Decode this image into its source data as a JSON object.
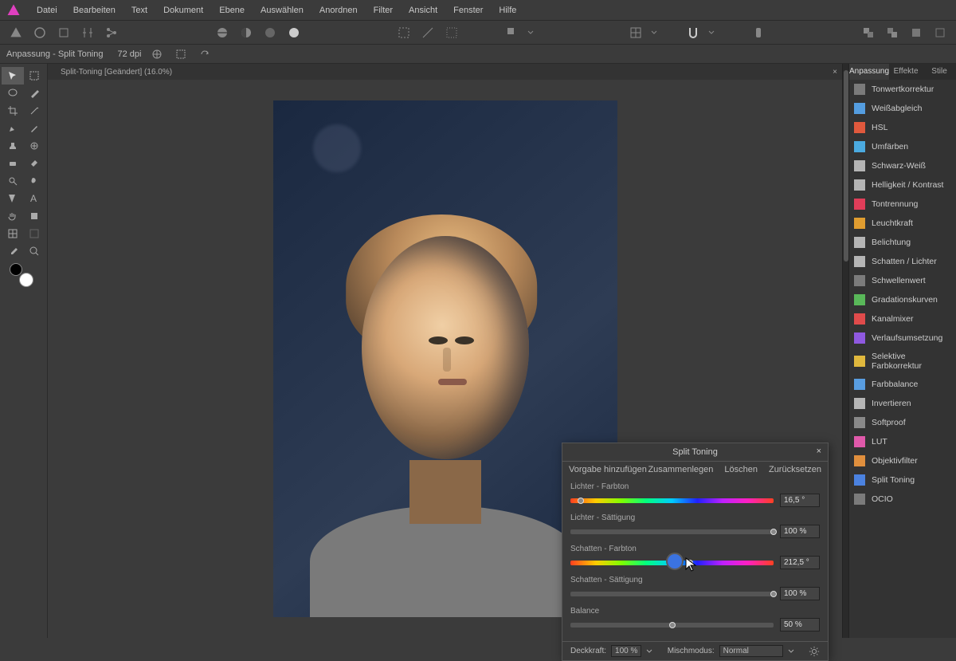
{
  "menu": [
    "Datei",
    "Bearbeiten",
    "Text",
    "Dokument",
    "Ebene",
    "Auswählen",
    "Anordnen",
    "Filter",
    "Ansicht",
    "Fenster",
    "Hilfe"
  ],
  "context": {
    "title": "Anpassung - Split Toning",
    "dpi": "72 dpi"
  },
  "tab": {
    "label": "Split-Toning [Geändert] (16.0%)"
  },
  "right_tabs": [
    "Anpassung",
    "Effekte",
    "Stile"
  ],
  "adjustments": [
    {
      "label": "Tonwertkorrektur",
      "icon": "levels"
    },
    {
      "label": "Weißabgleich",
      "icon": "wb"
    },
    {
      "label": "HSL",
      "icon": "hsl"
    },
    {
      "label": "Umfärben",
      "icon": "recolor"
    },
    {
      "label": "Schwarz-Weiß",
      "icon": "bw"
    },
    {
      "label": "Helligkeit / Kontrast",
      "icon": "bc"
    },
    {
      "label": "Tontrennung",
      "icon": "posterize"
    },
    {
      "label": "Leuchtkraft",
      "icon": "vibrance"
    },
    {
      "label": "Belichtung",
      "icon": "exposure"
    },
    {
      "label": "Schatten / Lichter",
      "icon": "sh"
    },
    {
      "label": "Schwellenwert",
      "icon": "threshold"
    },
    {
      "label": "Gradationskurven",
      "icon": "curves"
    },
    {
      "label": "Kanalmixer",
      "icon": "channelmix"
    },
    {
      "label": "Verlaufsumsetzung",
      "icon": "gradientmap"
    },
    {
      "label": "Selektive Farbkorrektur",
      "icon": "selective"
    },
    {
      "label": "Farbbalance",
      "icon": "colorbal"
    },
    {
      "label": "Invertieren",
      "icon": "invert"
    },
    {
      "label": "Softproof",
      "icon": "softproof"
    },
    {
      "label": "LUT",
      "icon": "lut"
    },
    {
      "label": "Objektivfilter",
      "icon": "lensfilter"
    },
    {
      "label": "Split Toning",
      "icon": "splittone"
    },
    {
      "label": "OCIO",
      "icon": "ocio"
    }
  ],
  "dialog": {
    "title": "Split Toning",
    "actions": {
      "add": "Vorgabe hinzufügen",
      "merge": "Zusammenlegen",
      "delete": "Löschen",
      "reset": "Zurücksetzen"
    },
    "sliders": {
      "highlight_hue": {
        "label": "Lichter - Farbton",
        "value": "16,5 °",
        "pos": 5
      },
      "highlight_sat": {
        "label": "Lichter - Sättigung",
        "value": "100 %",
        "pos": 100
      },
      "shadow_hue": {
        "label": "Schatten - Farbton",
        "value": "212,5 °",
        "pos": 59
      },
      "shadow_sat": {
        "label": "Schatten - Sättigung",
        "value": "100 %",
        "pos": 100
      },
      "balance": {
        "label": "Balance",
        "value": "50 %",
        "pos": 50
      }
    },
    "footer": {
      "opacity_label": "Deckkraft:",
      "opacity_value": "100 %",
      "blend_label": "Mischmodus:",
      "blend_value": "Normal"
    }
  },
  "icon_glyphs": {
    "levels": "▮",
    "wb": "◑",
    "hsl": "▦",
    "recolor": "▤",
    "bw": "◧",
    "bc": "◐",
    "posterize": "◩",
    "vibrance": "≡",
    "exposure": "◨",
    "sh": "◪",
    "threshold": "▥",
    "curves": "〰",
    "channelmix": "✢",
    "gradientmap": "▬",
    "selective": "▦",
    "colorbal": "⬤",
    "invert": "◻",
    "softproof": "▧",
    "lut": "▦",
    "lensfilter": "◯",
    "splittone": "◧",
    "ocio": "oc"
  },
  "adj_colors": {
    "levels": "#888",
    "wb": "#5ab0ff",
    "hsl": "#ff6040",
    "recolor": "#50c0ff",
    "bw": "#ccc",
    "bc": "#ccc",
    "posterize": "#ff4060",
    "vibrance": "#ffb030",
    "exposure": "#ccc",
    "sh": "#ccc",
    "threshold": "#888",
    "curves": "#60d060",
    "channelmix": "#ff5050",
    "gradientmap": "#a060ff",
    "selective": "#ffd040",
    "colorbal": "#60b0ff",
    "invert": "#ccc",
    "softproof": "#999",
    "lut": "#ff60c0",
    "lensfilter": "#ffa040",
    "splittone": "#5090ff",
    "ocio": "#888"
  }
}
